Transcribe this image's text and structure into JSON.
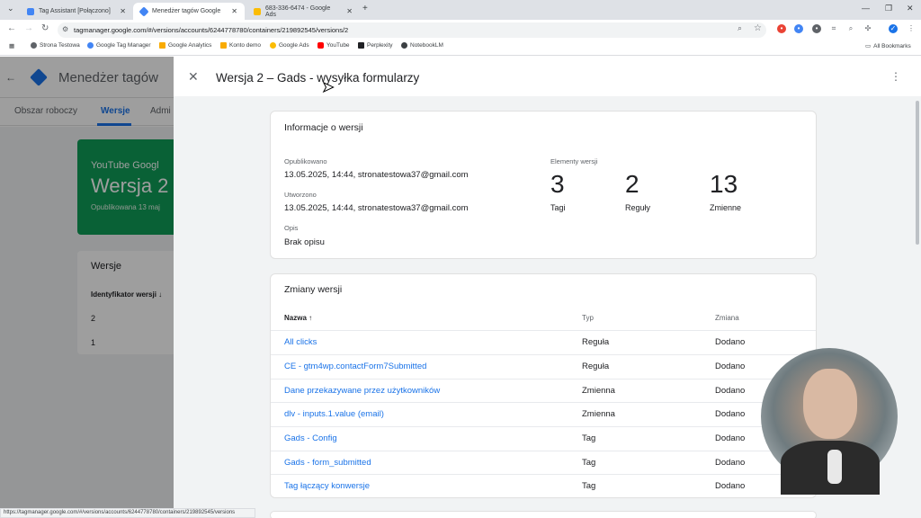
{
  "browser": {
    "tabs": [
      {
        "label": "Tag Assistant [Połączono]",
        "color": "#4285f4"
      },
      {
        "label": "Menedżer tagów Google",
        "color": "#4285f4"
      },
      {
        "label": "683-336-6474 - Google Ads",
        "color": "#fbbc04"
      }
    ],
    "url": "tagmanager.google.com/#/versions/accounts/6244778780/containers/219892545/versions/2",
    "bookmarks": [
      "Strona Testowa",
      "Google Tag Manager",
      "Google Analytics",
      "Konto demo",
      "Google Ads",
      "YouTube",
      "Perplexity",
      "NotebookLM"
    ],
    "all_bookmarks": "All Bookmarks",
    "status_url": "https://tagmanager.google.com/#/versions/accounts/6244778780/containers/219892545/versions"
  },
  "gtm": {
    "app_title": "Menedżer tagów",
    "tabs": [
      "Obszar roboczy",
      "Wersje",
      "Admi"
    ],
    "card": {
      "small": "YouTube Googl",
      "big": "Wersja 2",
      "sub": "Opublikowana 13 maj"
    },
    "versions_list": {
      "title": "Wersje",
      "column": "Identyfikator wersji",
      "sort_icon": "↓",
      "rows": [
        "2",
        "1"
      ]
    }
  },
  "panel": {
    "title": "Wersja 2 – Gads - wysyłka formularzy",
    "info": {
      "title": "Informacje o wersji",
      "published_label": "Opublikowano",
      "published_value": "13.05.2025, 14:44, stronatestowa37@gmail.com",
      "created_label": "Utworzono",
      "created_value": "13.05.2025, 14:44, stronatestowa37@gmail.com",
      "desc_label": "Opis",
      "desc_value": "Brak opisu",
      "elements_label": "Elementy wersji",
      "counts": [
        {
          "value": "3",
          "label": "Tagi"
        },
        {
          "value": "2",
          "label": "Reguły"
        },
        {
          "value": "13",
          "label": "Zmienne"
        }
      ]
    },
    "changes": {
      "title": "Zmiany wersji",
      "headers": {
        "name": "Nazwa",
        "sort": "↑",
        "type": "Typ",
        "change": "Zmiana"
      },
      "rows": [
        {
          "name": "All clicks",
          "type": "Reguła",
          "change": "Dodano"
        },
        {
          "name": "CE - gtm4wp.contactForm7Submitted",
          "type": "Reguła",
          "change": "Dodano"
        },
        {
          "name": "Dane przekazywane przez użytkowników",
          "type": "Zmienna",
          "change": "Dodano"
        },
        {
          "name": "dlv - inputs.1.value (email)",
          "type": "Zmienna",
          "change": "Dodano"
        },
        {
          "name": "Gads - Config",
          "type": "Tag",
          "change": "Dodano"
        },
        {
          "name": "Gads - form_submitted",
          "type": "Tag",
          "change": "Dodano"
        },
        {
          "name": "Tag łączący konwersje",
          "type": "Tag",
          "change": "Dodano"
        }
      ]
    }
  }
}
